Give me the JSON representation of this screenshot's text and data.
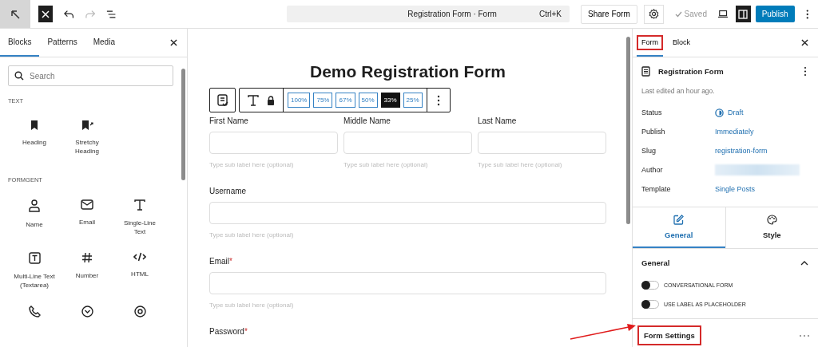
{
  "topbar": {
    "command_title": "Registration Form · Form",
    "shortcut": "Ctrl+K",
    "share_button": "Share Form",
    "saved": "Saved",
    "publish": "Publish"
  },
  "inserter": {
    "tabs": [
      {
        "label": "Blocks",
        "selected": true
      },
      {
        "label": "Patterns",
        "selected": false
      },
      {
        "label": "Media",
        "selected": false
      }
    ],
    "search": {
      "placeholder": "Search"
    },
    "sections": [
      {
        "title": "TEXT",
        "blocks": [
          {
            "kind": "heading",
            "label": "Heading"
          },
          {
            "kind": "stretchy",
            "label": "Stretchy Heading"
          }
        ]
      },
      {
        "title": "FORMGENT",
        "blocks": [
          {
            "kind": "name",
            "label": "Name"
          },
          {
            "kind": "email",
            "label": "Email"
          },
          {
            "kind": "single",
            "label": "Single-Line Text"
          },
          {
            "kind": "multi",
            "label": "Multi-Line Text (Textarea)"
          },
          {
            "kind": "number",
            "label": "Number"
          },
          {
            "kind": "html",
            "label": "HTML"
          },
          {
            "kind": "phone"
          },
          {
            "kind": "select"
          },
          {
            "kind": "radio"
          }
        ]
      }
    ]
  },
  "canvas": {
    "title": "Demo Registration Form",
    "widths": [
      {
        "label": "100%",
        "selected": false
      },
      {
        "label": "75%",
        "selected": false
      },
      {
        "label": "67%",
        "selected": false
      },
      {
        "label": "50%",
        "selected": false
      },
      {
        "label": "33%",
        "selected": true
      },
      {
        "label": "25%",
        "selected": false
      }
    ],
    "rows": [
      {
        "fields": [
          {
            "label": "First Name",
            "sublabel": "Type sub label here (optional)"
          },
          {
            "label": "Middle Name",
            "sublabel": "Type sub label here (optional)"
          },
          {
            "label": "Last Name",
            "sublabel": "Type sub label here (optional)"
          }
        ]
      },
      {
        "fields": [
          {
            "label": "Username",
            "sublabel": "Type sub label here (optional)"
          }
        ]
      },
      {
        "fields": [
          {
            "label": "Email",
            "required_mark": "*",
            "sublabel": "Type sub label here (optional)"
          }
        ]
      },
      {
        "fields": [
          {
            "label": "Password",
            "required_mark": "*"
          }
        ]
      }
    ]
  },
  "sidebar": {
    "tabs": [
      {
        "label": "Form",
        "selected": true,
        "highlighted": true
      },
      {
        "label": "Block",
        "selected": false,
        "highlighted": false
      }
    ],
    "doc_title": "Registration Form",
    "last_edited": "Last edited an hour ago.",
    "meta": [
      {
        "label": "Status",
        "value": "Draft",
        "kind": "status"
      },
      {
        "label": "Publish",
        "value": "Immediately",
        "kind": "link"
      },
      {
        "label": "Slug",
        "value": "registration-form",
        "kind": "link"
      },
      {
        "label": "Author",
        "kind": "blurred"
      },
      {
        "label": "Template",
        "value": "Single Posts",
        "kind": "link"
      }
    ],
    "panel_tabs": [
      {
        "label": "General",
        "kind": "general",
        "selected": true
      },
      {
        "label": "Style",
        "kind": "style",
        "selected": false
      }
    ],
    "general": {
      "title": "General",
      "expanded": true,
      "toggles": [
        {
          "label": "CONVERSATIONAL FORM",
          "on": false
        },
        {
          "label": "USE LABEL AS PLACEHOLDER",
          "on": false
        }
      ]
    },
    "form_settings": {
      "title": "Form Settings",
      "highlighted": true
    }
  }
}
